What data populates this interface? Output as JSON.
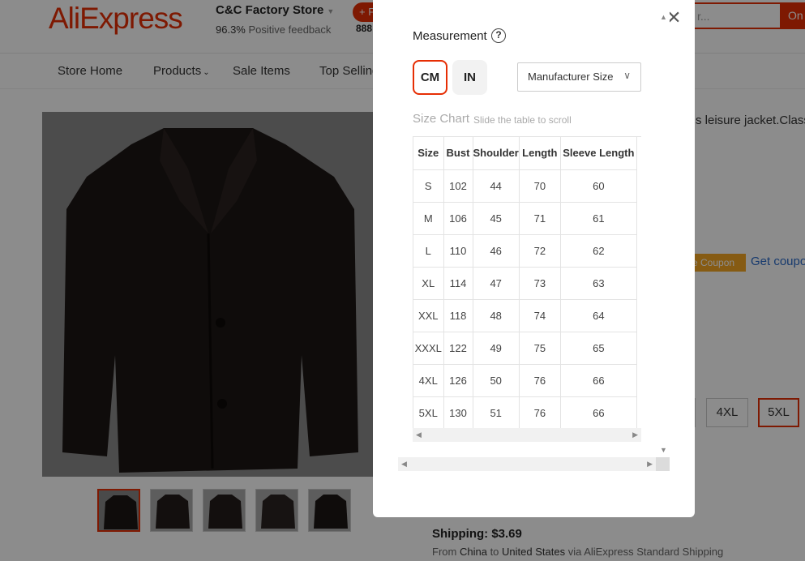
{
  "header": {
    "logo": "AliExpress",
    "store_name": "C&C Factory Store",
    "feedback_pct": "96.3%",
    "feedback_label": "Positive feedback",
    "follow_label": "+ F",
    "followers": "888",
    "search_placeholder": "r...",
    "search_button": "On"
  },
  "nav": {
    "items": [
      "Store Home",
      "Products",
      "Sale Items",
      "Top Selling"
    ]
  },
  "product": {
    "description_snippet": "s leisure jacket.Class",
    "coupon_badge": "e Coupon",
    "get_coupon": "Get coupo",
    "sizes_visible": [
      "",
      "4XL",
      "5XL"
    ],
    "selected_size": "5XL",
    "shipping": "Shipping: $3.69",
    "ship_from_prefix": "From",
    "ship_from": "China",
    "ship_to_prefix": "to",
    "ship_to": "United States",
    "ship_via": "via AliExpress Standard Shipping"
  },
  "modal": {
    "title": "Measurement",
    "help_icon": "?",
    "units": [
      "CM",
      "IN"
    ],
    "active_unit": "CM",
    "size_type": "Manufacturer Size",
    "chart_label": "Size Chart",
    "chart_hint": "Slide the table to scroll",
    "columns": [
      "Size",
      "Bust",
      "Shoulder",
      "Length",
      "Sleeve Length"
    ],
    "rows": [
      [
        "S",
        "102",
        "44",
        "70",
        "60"
      ],
      [
        "M",
        "106",
        "45",
        "71",
        "61"
      ],
      [
        "L",
        "110",
        "46",
        "72",
        "62"
      ],
      [
        "XL",
        "114",
        "47",
        "73",
        "63"
      ],
      [
        "XXL",
        "118",
        "48",
        "74",
        "64"
      ],
      [
        "XXXL",
        "122",
        "49",
        "75",
        "65"
      ],
      [
        "4XL",
        "126",
        "50",
        "76",
        "66"
      ],
      [
        "5XL",
        "130",
        "51",
        "76",
        "66"
      ]
    ]
  },
  "colors": {
    "brand_red": "#e62e04",
    "coupon_orange": "#f5a623",
    "link_blue": "#2a6ac8"
  }
}
